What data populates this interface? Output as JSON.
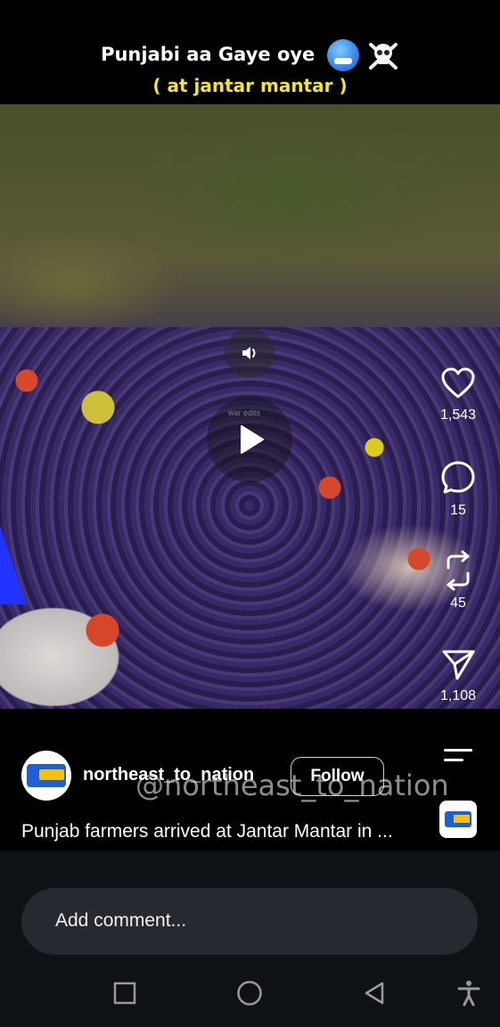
{
  "caption": {
    "line1": "Punjabi aa Gaye oye",
    "line2": "( at jantar mantar )",
    "emoji_1": "freezing-face-icon",
    "emoji_2": "skull-crossbones-icon"
  },
  "video": {
    "small_watermark": "war edits",
    "mute_icon": "speaker-icon",
    "play_icon": "play-icon"
  },
  "actions": {
    "likes": "1,543",
    "comments": "15",
    "reposts": "45",
    "shares": "1,108"
  },
  "post": {
    "username": "northeast_to_nation",
    "follow_label": "Follow",
    "overlay_handle": "@northeast_to_nation",
    "description": "Punjab farmers arrived at Jantar Mantar in ..."
  },
  "comment": {
    "placeholder": "Add comment..."
  },
  "colors": {
    "caption_accent": "#f5e71a",
    "bottom_background": "#0e1215",
    "comment_box": "#262a30"
  }
}
